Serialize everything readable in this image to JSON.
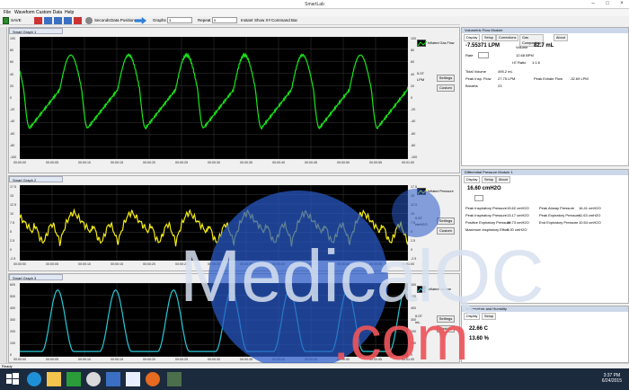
{
  "window": {
    "title": "SmartLab"
  },
  "menu": [
    "File",
    "Waveform",
    "Custom Data",
    "Help"
  ],
  "toolbar": {
    "save_label": "SAVE",
    "seconds_label": "Seconds",
    "data_position_label": "Data Position",
    "graphs_label": "Graphs",
    "graphs_value": "3",
    "repeat_label": "Repeat",
    "repeat_value": "0",
    "instant_label": "Instant",
    "show_xy_label": "Show XY",
    "command_bar_label": "Command Bar"
  },
  "graphs": [
    {
      "title": "Smart Graph 1",
      "legend": "Inflated Gas Flow",
      "color": "#19e619",
      "side_value": "0.07",
      "side_unit": "LPM",
      "yticks_left": [
        "100",
        "80",
        "60",
        "40",
        "20",
        "0",
        "-20",
        "-40",
        "-60",
        "-80",
        "-100"
      ],
      "yticks_right": [
        "100",
        "80",
        "60",
        "40",
        "20",
        "0",
        "-20",
        "-40",
        "-60",
        "-80",
        "-100"
      ],
      "xticks": [
        "00:00:00",
        "00:00:05",
        "00:00:10",
        "00:00:15",
        "00:00:20",
        "00:00:25",
        "00:00:30",
        "00:00:35",
        "00:00:40",
        "00:00:45",
        "00:00:50",
        "00:00:55",
        "00:01:00"
      ],
      "buttons": [
        "Settings",
        "Custom"
      ]
    },
    {
      "title": "Smart Graph 2",
      "legend": "Inflated Pressure",
      "color": "#f2ea17",
      "side_value": "0.57",
      "side_unit": "cmH2O",
      "yticks_left": [
        "17.5",
        "15",
        "12.5",
        "10",
        "7.5",
        "5",
        "2.5",
        "0",
        "-2.5"
      ],
      "yticks_right": [
        "17.5",
        "15",
        "12.5",
        "10",
        "7.5",
        "5",
        "2.5",
        "0",
        "-2.5"
      ],
      "xticks": [
        "00:00:00",
        "00:00:05",
        "00:00:10",
        "00:00:15",
        "00:00:20",
        "00:00:25",
        "00:00:30",
        "00:00:35",
        "00:00:40",
        "00:00:45",
        "00:00:50",
        "00:00:55",
        "00:01:00"
      ],
      "buttons": [
        "Settings",
        "Custom"
      ]
    },
    {
      "title": "Smart Graph 3",
      "legend": "Inflated Volume",
      "color": "#27c9d6",
      "side_value": "0.07",
      "side_unit": "mL",
      "yticks_left": [
        "600",
        "500",
        "400",
        "300",
        "200",
        "100",
        "0"
      ],
      "yticks_right": [
        "600",
        "500",
        "400",
        "300",
        "200",
        "100",
        "0"
      ],
      "xticks": [
        "00:00:00",
        "00:00:05",
        "00:00:10",
        "00:00:15",
        "00:00:20",
        "00:00:25",
        "00:00:30",
        "00:00:35",
        "00:00:40",
        "00:00:45",
        "00:00:50",
        "00:00:55",
        "00:01:00"
      ],
      "buttons": [
        "Settings",
        "Custom"
      ]
    }
  ],
  "flow_panel": {
    "title": "Volumetric Flow Module",
    "tabs": [
      "Display",
      "Setup",
      "Corrections",
      "Gas Composition",
      "About"
    ],
    "main_value": "-7.55371 LPM",
    "volume_label": "Volume",
    "volume_value": "82.7 mL",
    "rate_label": "Rate",
    "rate_value": "12.68 BPM",
    "ie_label": "I:E Ratio",
    "ie_value": "1:1.6",
    "tidal_label": "Tidal Volume",
    "tidal_value": "495.2 mL",
    "peak_insp_label": "Peak Insp. Flow",
    "peak_insp_value": "27.75 LPM",
    "peak_exp_label": "Peak Exhale Flow",
    "peak_exp_value": "-32.69 LPM",
    "breaths_label": "Breaths",
    "breaths_value": "23"
  },
  "pressure_panel": {
    "title": "Differential Pressure Module 1",
    "tabs": [
      "Display",
      "Setup",
      "About"
    ],
    "main_value": "16.60 cmH2O",
    "rows": [
      [
        "Peak Inspiratory Pressure",
        "15.62 cmH2O",
        "Peak Airway Pressure",
        "16.41 cmH2O"
      ],
      [
        "Peak Inspiratory Pressure",
        "13.17 cmH2O",
        "Peak Expiratory Pressure",
        "11.63 cmH2O"
      ],
      [
        "Positive Expiratory Pressure",
        "10.73 cmH2O",
        "End Expiratory Pressure",
        "10.54 cmH2O"
      ],
      [
        "Maximum Inspiratory Effort",
        "0.00 cmH2O",
        "",
        ""
      ]
    ]
  },
  "temp_panel": {
    "title": "Temperature and Humidity",
    "tabs": [
      "Display",
      "Setup"
    ],
    "temp_value": "22.66 C",
    "humidity_value": "13.60 %"
  },
  "watermark": {
    "text_a": "MedicalQC",
    "text_b": ".com"
  },
  "statusbar": {
    "text": "Ready"
  },
  "clock": {
    "time": "3:37 PM",
    "date": "6/24/2015"
  }
}
